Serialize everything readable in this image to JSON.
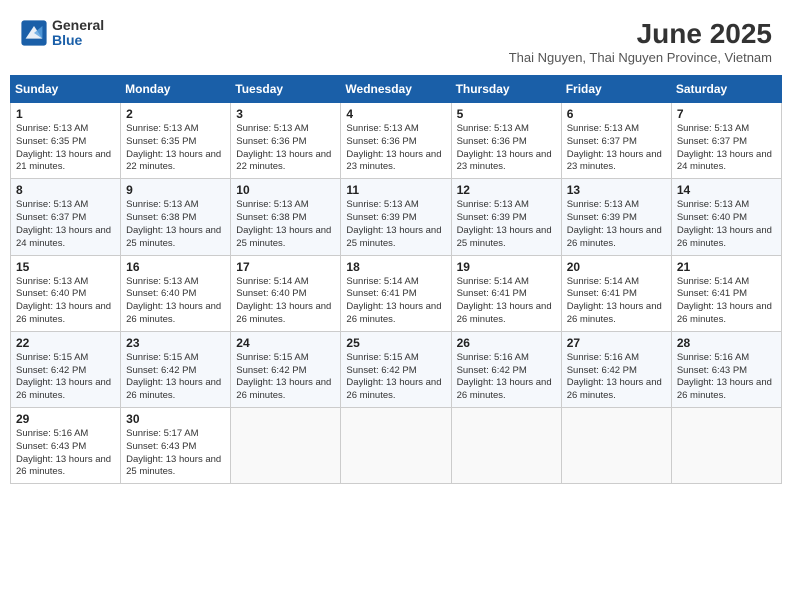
{
  "logo": {
    "general": "General",
    "blue": "Blue"
  },
  "title": "June 2025",
  "subtitle": "Thai Nguyen, Thai Nguyen Province, Vietnam",
  "weekdays": [
    "Sunday",
    "Monday",
    "Tuesday",
    "Wednesday",
    "Thursday",
    "Friday",
    "Saturday"
  ],
  "weeks": [
    [
      {
        "day": "1",
        "info": "Sunrise: 5:13 AM\nSunset: 6:35 PM\nDaylight: 13 hours\nand 21 minutes."
      },
      {
        "day": "2",
        "info": "Sunrise: 5:13 AM\nSunset: 6:35 PM\nDaylight: 13 hours\nand 22 minutes."
      },
      {
        "day": "3",
        "info": "Sunrise: 5:13 AM\nSunset: 6:36 PM\nDaylight: 13 hours\nand 22 minutes."
      },
      {
        "day": "4",
        "info": "Sunrise: 5:13 AM\nSunset: 6:36 PM\nDaylight: 13 hours\nand 23 minutes."
      },
      {
        "day": "5",
        "info": "Sunrise: 5:13 AM\nSunset: 6:36 PM\nDaylight: 13 hours\nand 23 minutes."
      },
      {
        "day": "6",
        "info": "Sunrise: 5:13 AM\nSunset: 6:37 PM\nDaylight: 13 hours\nand 23 minutes."
      },
      {
        "day": "7",
        "info": "Sunrise: 5:13 AM\nSunset: 6:37 PM\nDaylight: 13 hours\nand 24 minutes."
      }
    ],
    [
      {
        "day": "8",
        "info": "Sunrise: 5:13 AM\nSunset: 6:37 PM\nDaylight: 13 hours\nand 24 minutes."
      },
      {
        "day": "9",
        "info": "Sunrise: 5:13 AM\nSunset: 6:38 PM\nDaylight: 13 hours\nand 25 minutes."
      },
      {
        "day": "10",
        "info": "Sunrise: 5:13 AM\nSunset: 6:38 PM\nDaylight: 13 hours\nand 25 minutes."
      },
      {
        "day": "11",
        "info": "Sunrise: 5:13 AM\nSunset: 6:39 PM\nDaylight: 13 hours\nand 25 minutes."
      },
      {
        "day": "12",
        "info": "Sunrise: 5:13 AM\nSunset: 6:39 PM\nDaylight: 13 hours\nand 25 minutes."
      },
      {
        "day": "13",
        "info": "Sunrise: 5:13 AM\nSunset: 6:39 PM\nDaylight: 13 hours\nand 26 minutes."
      },
      {
        "day": "14",
        "info": "Sunrise: 5:13 AM\nSunset: 6:40 PM\nDaylight: 13 hours\nand 26 minutes."
      }
    ],
    [
      {
        "day": "15",
        "info": "Sunrise: 5:13 AM\nSunset: 6:40 PM\nDaylight: 13 hours\nand 26 minutes."
      },
      {
        "day": "16",
        "info": "Sunrise: 5:13 AM\nSunset: 6:40 PM\nDaylight: 13 hours\nand 26 minutes."
      },
      {
        "day": "17",
        "info": "Sunrise: 5:14 AM\nSunset: 6:40 PM\nDaylight: 13 hours\nand 26 minutes."
      },
      {
        "day": "18",
        "info": "Sunrise: 5:14 AM\nSunset: 6:41 PM\nDaylight: 13 hours\nand 26 minutes."
      },
      {
        "day": "19",
        "info": "Sunrise: 5:14 AM\nSunset: 6:41 PM\nDaylight: 13 hours\nand 26 minutes."
      },
      {
        "day": "20",
        "info": "Sunrise: 5:14 AM\nSunset: 6:41 PM\nDaylight: 13 hours\nand 26 minutes."
      },
      {
        "day": "21",
        "info": "Sunrise: 5:14 AM\nSunset: 6:41 PM\nDaylight: 13 hours\nand 26 minutes."
      }
    ],
    [
      {
        "day": "22",
        "info": "Sunrise: 5:15 AM\nSunset: 6:42 PM\nDaylight: 13 hours\nand 26 minutes."
      },
      {
        "day": "23",
        "info": "Sunrise: 5:15 AM\nSunset: 6:42 PM\nDaylight: 13 hours\nand 26 minutes."
      },
      {
        "day": "24",
        "info": "Sunrise: 5:15 AM\nSunset: 6:42 PM\nDaylight: 13 hours\nand 26 minutes."
      },
      {
        "day": "25",
        "info": "Sunrise: 5:15 AM\nSunset: 6:42 PM\nDaylight: 13 hours\nand 26 minutes."
      },
      {
        "day": "26",
        "info": "Sunrise: 5:16 AM\nSunset: 6:42 PM\nDaylight: 13 hours\nand 26 minutes."
      },
      {
        "day": "27",
        "info": "Sunrise: 5:16 AM\nSunset: 6:42 PM\nDaylight: 13 hours\nand 26 minutes."
      },
      {
        "day": "28",
        "info": "Sunrise: 5:16 AM\nSunset: 6:43 PM\nDaylight: 13 hours\nand 26 minutes."
      }
    ],
    [
      {
        "day": "29",
        "info": "Sunrise: 5:16 AM\nSunset: 6:43 PM\nDaylight: 13 hours\nand 26 minutes."
      },
      {
        "day": "30",
        "info": "Sunrise: 5:17 AM\nSunset: 6:43 PM\nDaylight: 13 hours\nand 25 minutes."
      },
      {
        "day": "",
        "info": ""
      },
      {
        "day": "",
        "info": ""
      },
      {
        "day": "",
        "info": ""
      },
      {
        "day": "",
        "info": ""
      },
      {
        "day": "",
        "info": ""
      }
    ]
  ]
}
